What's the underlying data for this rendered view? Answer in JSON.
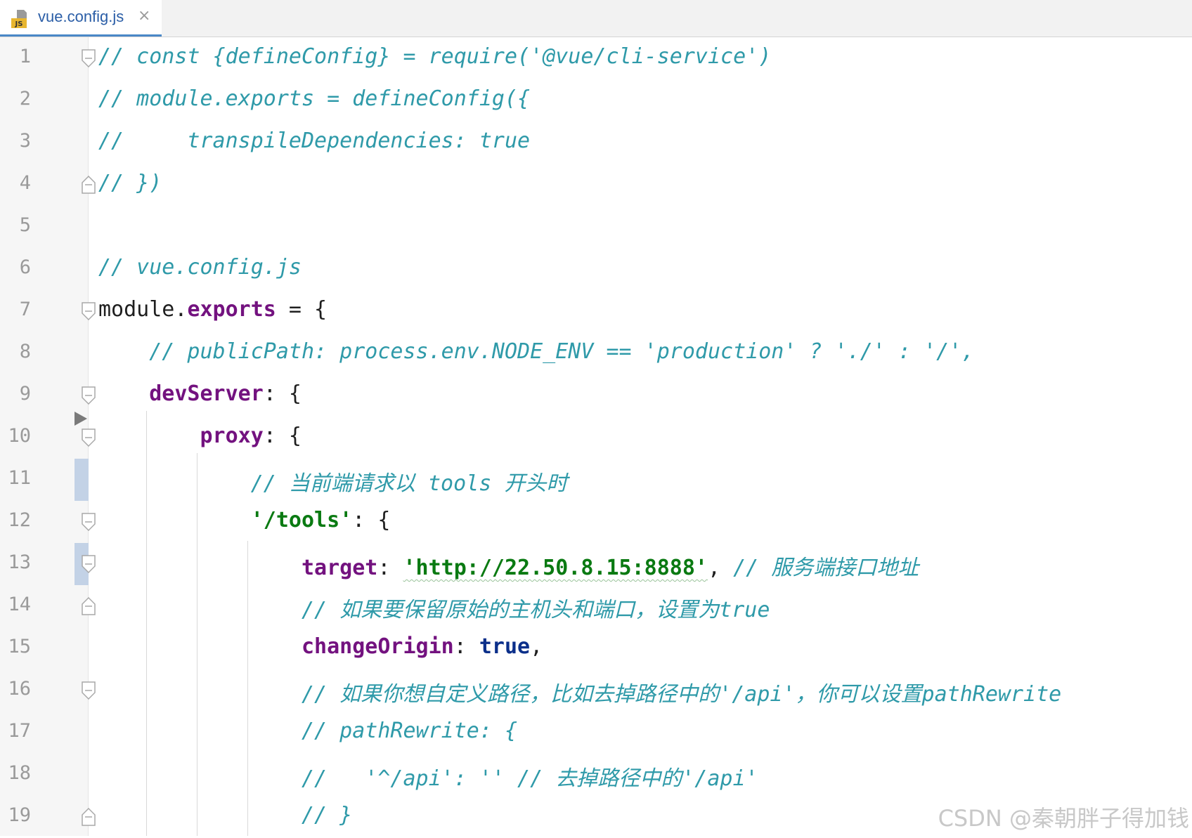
{
  "tab": {
    "title": "vue.config.js",
    "icon": "js-file-icon",
    "icon_badge": "JS",
    "close_glyph": "×"
  },
  "editor": {
    "lines": [
      {
        "number": "1",
        "fold": "open",
        "tokens": [
          {
            "cls": "cmt",
            "text": "// const {defineConfig} = require('@vue/cli-service')"
          }
        ]
      },
      {
        "number": "2",
        "tokens": [
          {
            "cls": "cmt",
            "text": "// module.exports = defineConfig({"
          }
        ]
      },
      {
        "number": "3",
        "tokens": [
          {
            "cls": "cmt",
            "text": "//     transpileDependencies: true"
          }
        ]
      },
      {
        "number": "4",
        "fold": "close",
        "tokens": [
          {
            "cls": "cmt",
            "text": "// })"
          }
        ]
      },
      {
        "number": "5",
        "tokens": []
      },
      {
        "number": "6",
        "tokens": [
          {
            "cls": "cmt",
            "text": "// vue.config.js"
          }
        ]
      },
      {
        "number": "7",
        "fold": "open",
        "tokens": [
          {
            "cls": "plain",
            "text": "module."
          },
          {
            "cls": "key",
            "text": "exports"
          },
          {
            "cls": "plain",
            "text": " = {"
          }
        ]
      },
      {
        "number": "8",
        "tokens": [
          {
            "cls": "plain",
            "text": "    "
          },
          {
            "cls": "cmt",
            "text": "// publicPath: process.env.NODE_ENV == 'production' ? './' : '/',"
          }
        ]
      },
      {
        "number": "9",
        "fold": "open",
        "tokens": [
          {
            "cls": "plain",
            "text": "    "
          },
          {
            "cls": "key",
            "text": "devServer"
          },
          {
            "cls": "plain",
            "text": ": {"
          }
        ]
      },
      {
        "number": "10",
        "fold": "open",
        "tokens": [
          {
            "cls": "plain",
            "text": "        "
          },
          {
            "cls": "key",
            "text": "proxy"
          },
          {
            "cls": "plain",
            "text": ": {"
          }
        ]
      },
      {
        "number": "11",
        "changed": true,
        "tokens": [
          {
            "cls": "plain",
            "text": "            "
          },
          {
            "cls": "cmt",
            "text": "// 当前端请求以 tools 开头时"
          }
        ]
      },
      {
        "number": "12",
        "fold": "open",
        "tokens": [
          {
            "cls": "plain",
            "text": "            "
          },
          {
            "cls": "str",
            "text": "'/tools'"
          },
          {
            "cls": "plain",
            "text": ": {"
          }
        ]
      },
      {
        "number": "13",
        "fold": "open",
        "changed": true,
        "tokens": [
          {
            "cls": "plain",
            "text": "                "
          },
          {
            "cls": "key",
            "text": "target"
          },
          {
            "cls": "plain",
            "text": ": "
          },
          {
            "cls": "strurl",
            "text": "'http://22.50.8.15:8888'"
          },
          {
            "cls": "plain",
            "text": ", "
          },
          {
            "cls": "cmt",
            "text": "// 服务端接口地址"
          }
        ]
      },
      {
        "number": "14",
        "fold": "close",
        "tokens": [
          {
            "cls": "plain",
            "text": "                "
          },
          {
            "cls": "cmt",
            "text": "// 如果要保留原始的主机头和端口，设置为true"
          }
        ]
      },
      {
        "number": "15",
        "tokens": [
          {
            "cls": "plain",
            "text": "                "
          },
          {
            "cls": "key",
            "text": "changeOrigin"
          },
          {
            "cls": "plain",
            "text": ": "
          },
          {
            "cls": "kw",
            "text": "true"
          },
          {
            "cls": "plain",
            "text": ","
          }
        ]
      },
      {
        "number": "16",
        "fold": "open",
        "tokens": [
          {
            "cls": "plain",
            "text": "                "
          },
          {
            "cls": "cmt",
            "text": "// 如果你想自定义路径，比如去掉路径中的'/api'，你可以设置pathRewrite"
          }
        ]
      },
      {
        "number": "17",
        "tokens": [
          {
            "cls": "plain",
            "text": "                "
          },
          {
            "cls": "cmt",
            "text": "// pathRewrite: {"
          }
        ]
      },
      {
        "number": "18",
        "tokens": [
          {
            "cls": "plain",
            "text": "                "
          },
          {
            "cls": "cmt",
            "text": "//   '^/api': '' // 去掉路径中的'/api'"
          }
        ]
      },
      {
        "number": "19",
        "fold": "close",
        "tokens": [
          {
            "cls": "plain",
            "text": "                "
          },
          {
            "cls": "cmt",
            "text": "// }"
          }
        ]
      }
    ]
  },
  "colors": {
    "comment": "#2f9aa9",
    "property": "#73127f",
    "string": "#0a7a12",
    "keyword": "#0b2f8a",
    "line_number": "#9a9a9a",
    "tab_accent": "#4a88c7"
  },
  "watermark": "CSDN @秦朝胖子得加钱"
}
